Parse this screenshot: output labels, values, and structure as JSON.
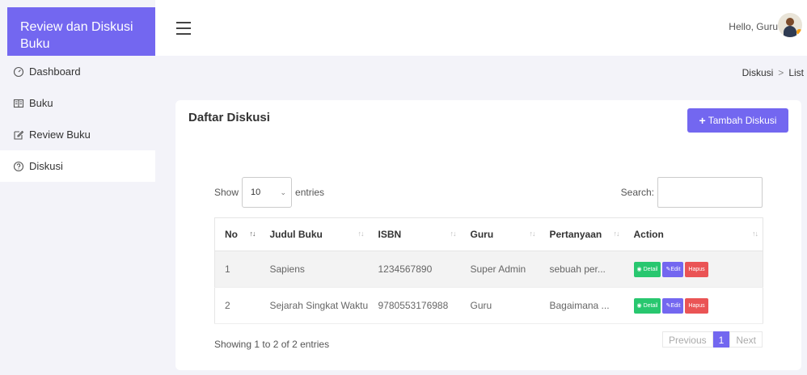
{
  "sidebar": {
    "brand": "Review dan Diskusi Buku",
    "items": [
      {
        "label": "Dashboard",
        "icon": "gauge-icon"
      },
      {
        "label": "Buku",
        "icon": "book-icon"
      },
      {
        "label": "Review Buku",
        "icon": "edit-icon"
      },
      {
        "label": "Diskusi",
        "icon": "help-circle-icon"
      }
    ]
  },
  "topbar": {
    "greeting": "Hello, Guru"
  },
  "breadcrumb": {
    "items": [
      "Diskusi",
      "List"
    ]
  },
  "card": {
    "title": "Daftar Diskusi",
    "add_label": "Tambah Diskusi"
  },
  "table_controls": {
    "show_label": "Show",
    "entries_value": "10",
    "entries_label": "entries",
    "search_label": "Search:"
  },
  "table": {
    "columns": [
      "No",
      "Judul Buku",
      "ISBN",
      "Guru",
      "Pertanyaan",
      "Action"
    ],
    "rows": [
      {
        "no": "1",
        "judul": "Sapiens",
        "isbn": "1234567890",
        "guru": "Super Admin",
        "pertanyaan": "sebuah per..."
      },
      {
        "no": "2",
        "judul": "Sejarah Singkat Waktu",
        "isbn": "9780553176988",
        "guru": "Guru",
        "pertanyaan": "Bagaimana ..."
      }
    ],
    "actions": {
      "detail": "Detail",
      "edit": "Edit",
      "hapus": "Hapus"
    }
  },
  "footer": {
    "info": "Showing 1 to 2 of 2 entries",
    "previous": "Previous",
    "page": "1",
    "next": "Next"
  }
}
